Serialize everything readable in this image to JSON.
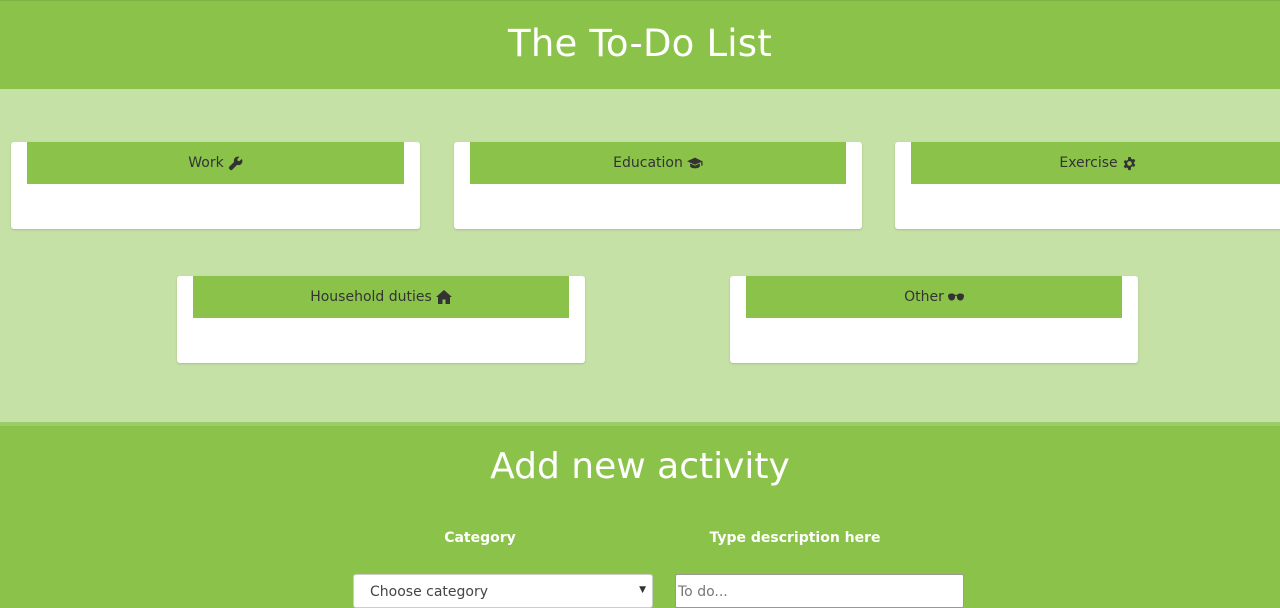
{
  "header": {
    "title": "The To-Do List"
  },
  "categories": [
    {
      "label": "Work",
      "icon": "wrench-icon"
    },
    {
      "label": "Education",
      "icon": "graduation-cap-icon"
    },
    {
      "label": "Exercise",
      "icon": "gear-icon"
    },
    {
      "label": "Household duties",
      "icon": "home-icon"
    },
    {
      "label": "Other",
      "icon": "sunglasses-icon"
    }
  ],
  "add_form": {
    "title": "Add new activity",
    "category_label": "Category",
    "description_label": "Type description here",
    "category_select_value": "Choose category",
    "description_placeholder": "To do..."
  },
  "colors": {
    "primary": "#8bc34a",
    "light": "#c5e1a5",
    "card": "#ffffff"
  }
}
